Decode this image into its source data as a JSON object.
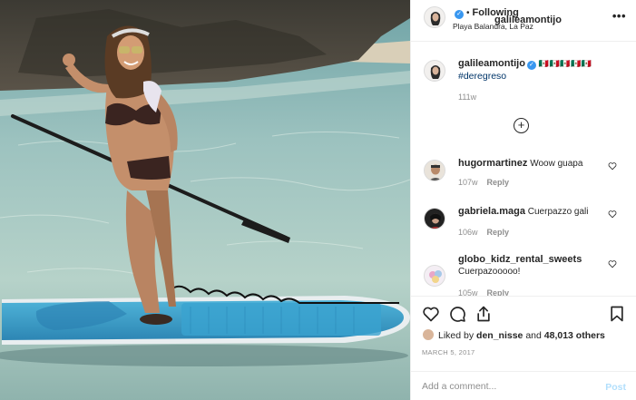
{
  "post": {
    "username": "galileamontijo",
    "follow_label": "Following",
    "location": "Playa Balandra, La Paz",
    "more_label": "• • •"
  },
  "caption": {
    "username": "galileamontijo",
    "flags": "🇲🇽🇲🇽🇲🇽🇲🇽🇲🇽",
    "hashtag": "#deregreso",
    "time": "111w"
  },
  "load_more_label": "+",
  "comments": [
    {
      "username": "hugormartinez",
      "text": "Woow guapa",
      "time": "107w",
      "reply": "Reply"
    },
    {
      "username": "gabriela.maga",
      "text": "Cuerpazzo gali",
      "time": "106w",
      "reply": "Reply"
    },
    {
      "username": "globo_kidz_rental_sweets",
      "text": "Cuerpazooooo!",
      "time": "105w",
      "reply": "Reply"
    }
  ],
  "likes": {
    "prefix": "Liked by",
    "user": "den_nisse",
    "joiner": "and",
    "count": "48,013 others"
  },
  "date": "MARCH 5, 2017",
  "add_comment": {
    "placeholder": "Add a comment...",
    "post_label": "Post"
  },
  "icons": {
    "verified": "verified-badge-icon",
    "like": "heart-icon",
    "comment": "comment-icon",
    "share": "share-icon",
    "save": "bookmark-icon"
  },
  "colors": {
    "link": "#003569",
    "verified": "#3897f0",
    "muted": "#8e8e8e",
    "post_disabled": "#b2dffc"
  }
}
